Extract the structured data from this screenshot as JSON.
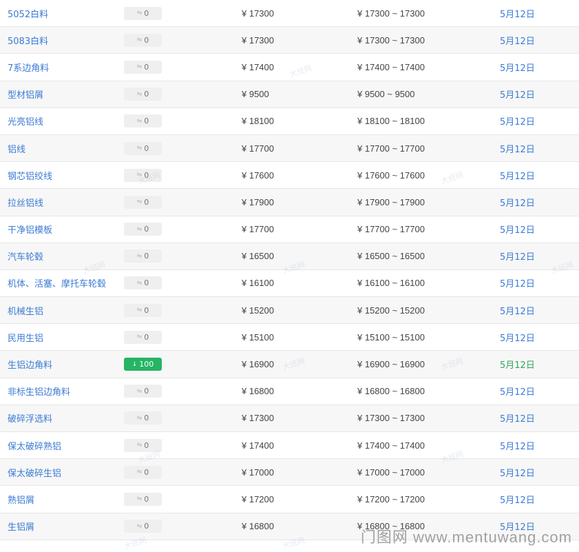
{
  "rows": [
    {
      "name": "5052白料",
      "change": "0",
      "dir": "flat",
      "price": "¥ 17300",
      "range": "¥ 17300 ~ 17300",
      "date": "5月12日"
    },
    {
      "name": "5083白料",
      "change": "0",
      "dir": "flat",
      "price": "¥ 17300",
      "range": "¥ 17300 ~ 17300",
      "date": "5月12日"
    },
    {
      "name": "7系边角料",
      "change": "0",
      "dir": "flat",
      "price": "¥ 17400",
      "range": "¥ 17400 ~ 17400",
      "date": "5月12日"
    },
    {
      "name": "型材铝屑",
      "change": "0",
      "dir": "flat",
      "price": "¥ 9500",
      "range": "¥ 9500 ~ 9500",
      "date": "5月12日"
    },
    {
      "name": "光亮铝线",
      "change": "0",
      "dir": "flat",
      "price": "¥ 18100",
      "range": "¥ 18100 ~ 18100",
      "date": "5月12日"
    },
    {
      "name": "铝线",
      "change": "0",
      "dir": "flat",
      "price": "¥ 17700",
      "range": "¥ 17700 ~ 17700",
      "date": "5月12日"
    },
    {
      "name": "钢芯铝绞线",
      "change": "0",
      "dir": "flat",
      "price": "¥ 17600",
      "range": "¥ 17600 ~ 17600",
      "date": "5月12日"
    },
    {
      "name": "拉丝铝线",
      "change": "0",
      "dir": "flat",
      "price": "¥ 17900",
      "range": "¥ 17900 ~ 17900",
      "date": "5月12日"
    },
    {
      "name": "干净铝模板",
      "change": "0",
      "dir": "flat",
      "price": "¥ 17700",
      "range": "¥ 17700 ~ 17700",
      "date": "5月12日"
    },
    {
      "name": "汽车轮毂",
      "change": "0",
      "dir": "flat",
      "price": "¥ 16500",
      "range": "¥ 16500 ~ 16500",
      "date": "5月12日"
    },
    {
      "name": "机体、活塞、摩托车轮毂",
      "change": "0",
      "dir": "flat",
      "price": "¥ 16100",
      "range": "¥ 16100 ~ 16100",
      "date": "5月12日"
    },
    {
      "name": "机械生铝",
      "change": "0",
      "dir": "flat",
      "price": "¥ 15200",
      "range": "¥ 15200 ~ 15200",
      "date": "5月12日"
    },
    {
      "name": "民用生铝",
      "change": "0",
      "dir": "flat",
      "price": "¥ 15100",
      "range": "¥ 15100 ~ 15100",
      "date": "5月12日"
    },
    {
      "name": "生铝边角料",
      "change": "100",
      "dir": "down",
      "price": "¥ 16900",
      "range": "¥ 16900 ~ 16900",
      "date": "5月12日"
    },
    {
      "name": "非标生铝边角料",
      "change": "0",
      "dir": "flat",
      "price": "¥ 16800",
      "range": "¥ 16800 ~ 16800",
      "date": "5月12日"
    },
    {
      "name": "破碎浮选料",
      "change": "0",
      "dir": "flat",
      "price": "¥ 17300",
      "range": "¥ 17300 ~ 17300",
      "date": "5月12日"
    },
    {
      "name": "保太破碎熟铝",
      "change": "0",
      "dir": "flat",
      "price": "¥ 17400",
      "range": "¥ 17400 ~ 17400",
      "date": "5月12日"
    },
    {
      "name": "保太破碎生铝",
      "change": "0",
      "dir": "flat",
      "price": "¥ 17000",
      "range": "¥ 17000 ~ 17000",
      "date": "5月12日"
    },
    {
      "name": "熟铝屑",
      "change": "0",
      "dir": "flat",
      "price": "¥ 17200",
      "range": "¥ 17200 ~ 17200",
      "date": "5月12日"
    },
    {
      "name": "生铝屑",
      "change": "0",
      "dir": "flat",
      "price": "¥ 16800",
      "range": "¥ 16800 ~ 16800",
      "date": "5月12日"
    }
  ],
  "icons": {
    "flat": "flat-arrow-icon",
    "down": "down-arrow-icon"
  },
  "colors": {
    "link": "#3b7bd4",
    "down_badge": "#25b464",
    "down_date": "#2fa55b",
    "flat_badge": "#efefef"
  },
  "watermark_text": "大班网",
  "site_watermark": "门图网 www.mentuwang.com"
}
